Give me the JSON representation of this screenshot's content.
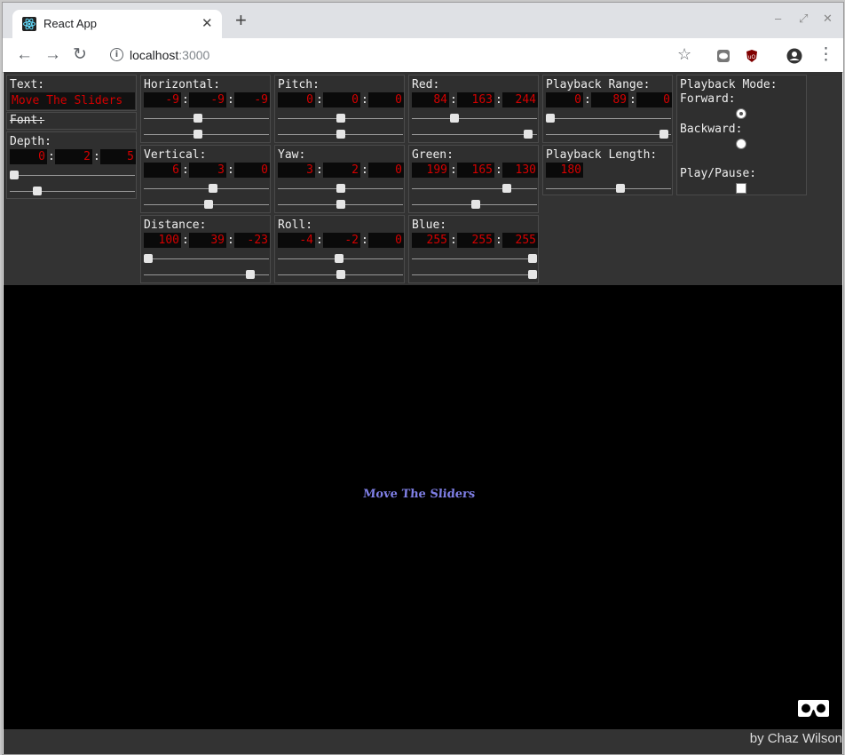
{
  "browser": {
    "tab_title": "React App",
    "url_host": "localhost",
    "url_port": ":3000"
  },
  "controls": {
    "text": {
      "label": "Text:",
      "value": "Move The Sliders"
    },
    "font": {
      "label": "Font:"
    },
    "depth": {
      "label": "Depth:",
      "values": [
        "0",
        "2",
        "5"
      ],
      "sliders": [
        0.0,
        0.2
      ]
    },
    "horizontal": {
      "label": "Horizontal:",
      "values": [
        "-9",
        "-9",
        "-9"
      ],
      "sliders": [
        0.43,
        0.43
      ]
    },
    "vertical": {
      "label": "Vertical:",
      "values": [
        "6",
        "3",
        "0"
      ],
      "sliders": [
        0.56,
        0.52
      ]
    },
    "distance": {
      "label": "Distance:",
      "values": [
        "100",
        "39",
        "-23"
      ],
      "sliders": [
        0.0,
        0.88
      ]
    },
    "pitch": {
      "label": "Pitch:",
      "values": [
        "0",
        "0",
        "0"
      ],
      "sliders": [
        0.5,
        0.5
      ]
    },
    "yaw": {
      "label": "Yaw:",
      "values": [
        "3",
        "2",
        "0"
      ],
      "sliders": [
        0.5,
        0.5
      ]
    },
    "roll": {
      "label": "Roll:",
      "values": [
        "-4",
        "-2",
        "0"
      ],
      "sliders": [
        0.49,
        0.5
      ]
    },
    "red": {
      "label": "Red:",
      "values": [
        "84",
        "163",
        "244"
      ],
      "sliders": [
        0.33,
        0.96
      ]
    },
    "green": {
      "label": "Green:",
      "values": [
        "199",
        "165",
        "130"
      ],
      "sliders": [
        0.78,
        0.51
      ]
    },
    "blue": {
      "label": "Blue:",
      "values": [
        "255",
        "255",
        "255"
      ],
      "sliders": [
        1.0,
        1.0
      ]
    },
    "playback_range": {
      "label": "Playback Range:",
      "values": [
        "0",
        "89",
        "0"
      ],
      "sliders": [
        0.0,
        0.98
      ]
    },
    "playback_length": {
      "label": "Playback Length:",
      "value": "180",
      "slider": 0.6
    },
    "playback_mode": {
      "label": "Playback Mode:",
      "forward_label": "Forward:",
      "backward_label": "Backward:",
      "selected": "forward",
      "play_label": "Play/Pause:",
      "playing": false
    }
  },
  "scene": {
    "text": "Move The Sliders",
    "text_color": "#7f7fe6"
  },
  "footer": {
    "credit": "by Chaz Wilson"
  }
}
